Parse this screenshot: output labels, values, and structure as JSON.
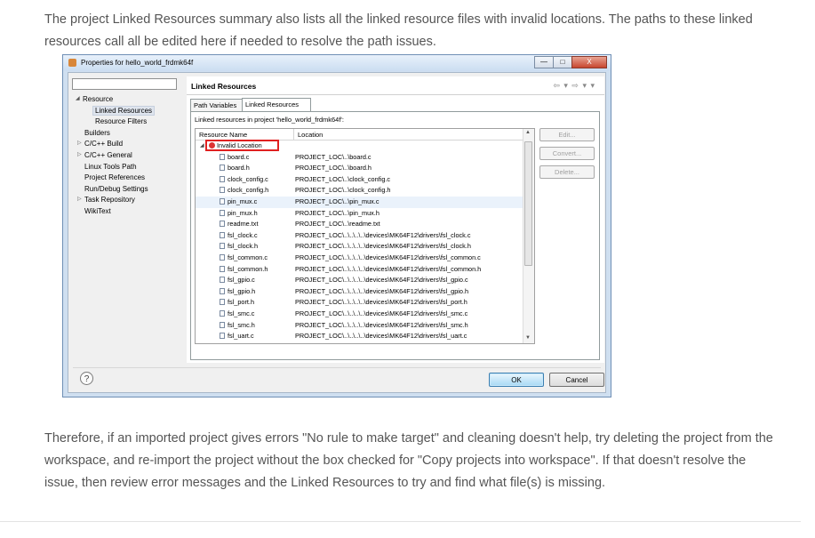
{
  "intro": "The project Linked Resources summary also lists all the linked resource files with invalid locations.  The paths to these linked resources call all be edited here if needed to resolve the path issues.",
  "outro": "Therefore, if an imported project gives errors \"No rule to make target\" and cleaning doesn't help, try deleting the project from the workspace, and re-import the project without the box checked for \"Copy projects into workspace\".  If that doesn't resolve the issue, then review error messages and the Linked Resources to try and find what file(s) is missing.",
  "dialog": {
    "title": "Properties for hello_world_frdmk64f",
    "filter_value": "",
    "page_title": "Linked Resources",
    "tabs": [
      "Path Variables",
      "Linked Resources"
    ],
    "tree": [
      {
        "label": "Resource",
        "arrow": "◢"
      },
      {
        "label": "Linked Resources",
        "selected": true
      },
      {
        "label": "Resource Filters"
      },
      {
        "label": "Builders"
      },
      {
        "label": "C/C++ Build",
        "arrow": "▷"
      },
      {
        "label": "C/C++ General",
        "arrow": "▷"
      },
      {
        "label": "Linux Tools Path"
      },
      {
        "label": "Project References"
      },
      {
        "label": "Run/Debug Settings"
      },
      {
        "label": "Task Repository",
        "arrow": "▷"
      },
      {
        "label": "WikiText"
      }
    ],
    "linked_label": "Linked resources in project 'hello_world_frdmk64f':",
    "columns": [
      "Resource Name",
      "Location"
    ],
    "group": "Invalid Location",
    "rows": [
      [
        "board.c",
        "PROJECT_LOC\\..\\board.c"
      ],
      [
        "board.h",
        "PROJECT_LOC\\..\\board.h"
      ],
      [
        "clock_config.c",
        "PROJECT_LOC\\..\\clock_config.c"
      ],
      [
        "clock_config.h",
        "PROJECT_LOC\\..\\clock_config.h"
      ],
      [
        "pin_mux.c",
        "PROJECT_LOC\\..\\pin_mux.c"
      ],
      [
        "pin_mux.h",
        "PROJECT_LOC\\..\\pin_mux.h"
      ],
      [
        "readme.txt",
        "PROJECT_LOC\\..\\readme.txt"
      ],
      [
        "fsl_clock.c",
        "PROJECT_LOC\\..\\..\\..\\..\\devices\\MK64F12\\drivers\\fsl_clock.c"
      ],
      [
        "fsl_clock.h",
        "PROJECT_LOC\\..\\..\\..\\..\\devices\\MK64F12\\drivers\\fsl_clock.h"
      ],
      [
        "fsl_common.c",
        "PROJECT_LOC\\..\\..\\..\\..\\devices\\MK64F12\\drivers\\fsl_common.c"
      ],
      [
        "fsl_common.h",
        "PROJECT_LOC\\..\\..\\..\\..\\devices\\MK64F12\\drivers\\fsl_common.h"
      ],
      [
        "fsl_gpio.c",
        "PROJECT_LOC\\..\\..\\..\\..\\devices\\MK64F12\\drivers\\fsl_gpio.c"
      ],
      [
        "fsl_gpio.h",
        "PROJECT_LOC\\..\\..\\..\\..\\devices\\MK64F12\\drivers\\fsl_gpio.h"
      ],
      [
        "fsl_port.h",
        "PROJECT_LOC\\..\\..\\..\\..\\devices\\MK64F12\\drivers\\fsl_port.h"
      ],
      [
        "fsl_smc.c",
        "PROJECT_LOC\\..\\..\\..\\..\\devices\\MK64F12\\drivers\\fsl_smc.c"
      ],
      [
        "fsl_smc.h",
        "PROJECT_LOC\\..\\..\\..\\..\\devices\\MK64F12\\drivers\\fsl_smc.h"
      ],
      [
        "fsl_uart.c",
        "PROJECT_LOC\\..\\..\\..\\..\\devices\\MK64F12\\drivers\\fsl_uart.c"
      ]
    ],
    "highlighted_row": 4,
    "buttons": {
      "edit": "Edit...",
      "convert": "Convert...",
      "delete": "Delete...",
      "ok": "OK",
      "cancel": "Cancel",
      "help": "?"
    },
    "window_buttons": {
      "minimize": "—",
      "maximize": "□",
      "close": "X"
    },
    "nav_arrows": "⇦ ▾ ⇨ ▾ ▾"
  }
}
